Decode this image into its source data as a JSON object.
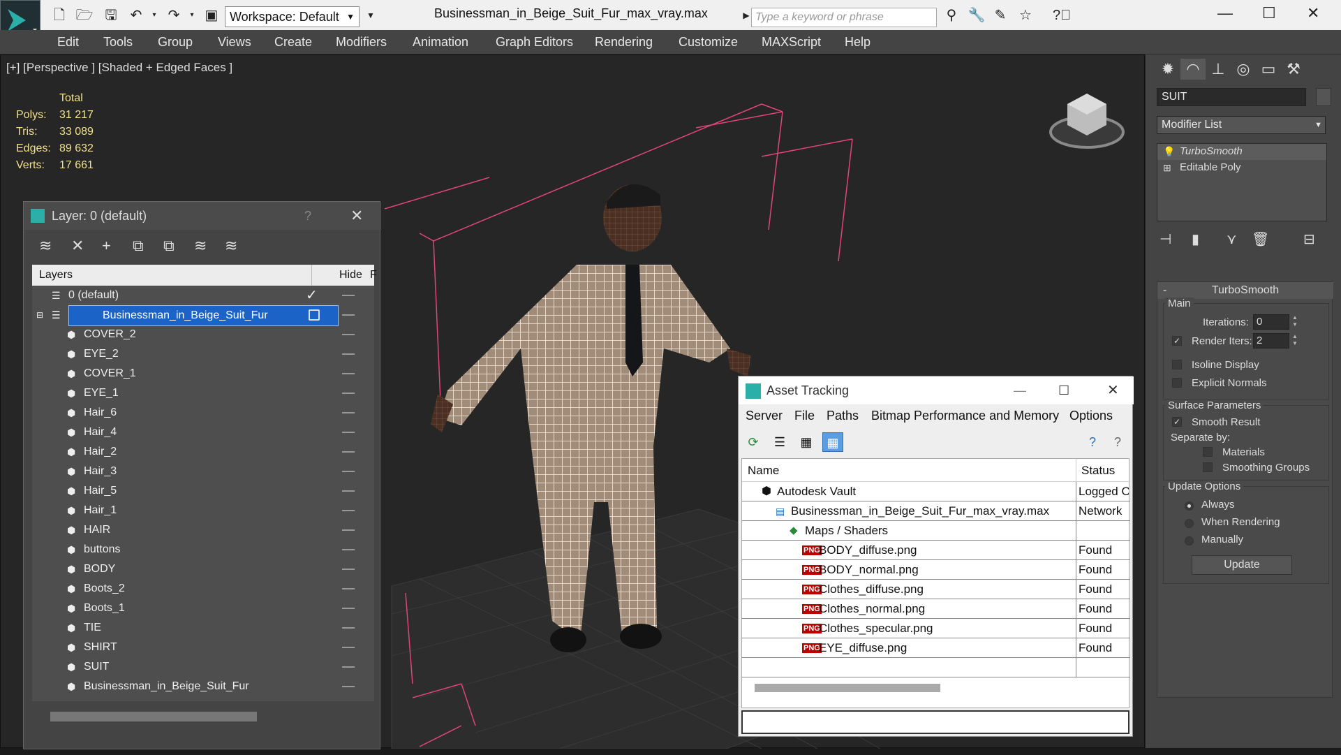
{
  "app": {
    "file_title": "Businessman_in_Beige_Suit_Fur_max_vray.max",
    "workspace": "Workspace: Default",
    "search_placeholder": "Type a keyword or phrase"
  },
  "menu": [
    "Edit",
    "Tools",
    "Group",
    "Views",
    "Create",
    "Modifiers",
    "Animation",
    "Graph Editors",
    "Rendering",
    "Customize",
    "MAXScript",
    "Help"
  ],
  "viewport": {
    "label": "[+] [Perspective ] [Shaded + Edged Faces ]",
    "stats_header": "Total",
    "stats": [
      {
        "label": "Polys:",
        "value": "31 217"
      },
      {
        "label": "Tris:",
        "value": "33 089"
      },
      {
        "label": "Edges:",
        "value": "89 632"
      },
      {
        "label": "Verts:",
        "value": "17 661"
      }
    ]
  },
  "command_panel": {
    "object_name": "SUIT",
    "modifier_list": "Modifier List",
    "stack": [
      "TurboSmooth",
      "Editable Poly"
    ],
    "rollout_title": "TurboSmooth",
    "main_label": "Main",
    "iterations_label": "Iterations:",
    "iterations_value": "0",
    "render_iters_label": "Render Iters:",
    "render_iters_value": "2",
    "render_iters_checked": true,
    "isoline_label": "Isoline Display",
    "explicit_normals_label": "Explicit Normals",
    "surface_label": "Surface Parameters",
    "smooth_result_label": "Smooth Result",
    "separate_by_label": "Separate by:",
    "materials_label": "Materials",
    "smoothing_groups_label": "Smoothing Groups",
    "update_options_label": "Update Options",
    "always_label": "Always",
    "when_rendering_label": "When Rendering",
    "manually_label": "Manually",
    "update_button": "Update"
  },
  "layer_window": {
    "title": "Layer: 0 (default)",
    "help": "?",
    "col_layers": "Layers",
    "col_hide": "Hide",
    "col_f": "F",
    "top_items": [
      "0 (default)",
      "Businessman_in_Beige_Suit_Fur"
    ],
    "children": [
      "COVER_2",
      "EYE_2",
      "COVER_1",
      "EYE_1",
      "Hair_6",
      "Hair_4",
      "Hair_2",
      "Hair_3",
      "Hair_5",
      "Hair_1",
      "HAIR",
      "buttons",
      "BODY",
      "Boots_2",
      "Boots_1",
      "TIE",
      "SHIRT",
      "SUIT",
      "Businessman_in_Beige_Suit_Fur"
    ]
  },
  "asset_tracking": {
    "title": "Asset Tracking",
    "menu": [
      "Server",
      "File",
      "Paths",
      "Bitmap Performance and Memory",
      "Options"
    ],
    "col_name": "Name",
    "col_status": "Status",
    "rows": [
      {
        "name": "Autodesk Vault",
        "status": "Logged O",
        "indent": 0
      },
      {
        "name": "Businessman_in_Beige_Suit_Fur_max_vray.max",
        "status": "Network",
        "indent": 1
      },
      {
        "name": "Maps / Shaders",
        "status": "",
        "indent": 2
      },
      {
        "name": "BODY_diffuse.png",
        "status": "Found",
        "indent": 3
      },
      {
        "name": "BODY_normal.png",
        "status": "Found",
        "indent": 3
      },
      {
        "name": "Clothes_diffuse.png",
        "status": "Found",
        "indent": 3
      },
      {
        "name": "Clothes_normal.png",
        "status": "Found",
        "indent": 3
      },
      {
        "name": "Clothes_specular.png",
        "status": "Found",
        "indent": 3
      },
      {
        "name": "EYE_diffuse.png",
        "status": "Found",
        "indent": 3
      }
    ]
  },
  "colors": {
    "accent": "#1c63c7",
    "stats": "#f2e08a",
    "helper": "#e0457b"
  }
}
